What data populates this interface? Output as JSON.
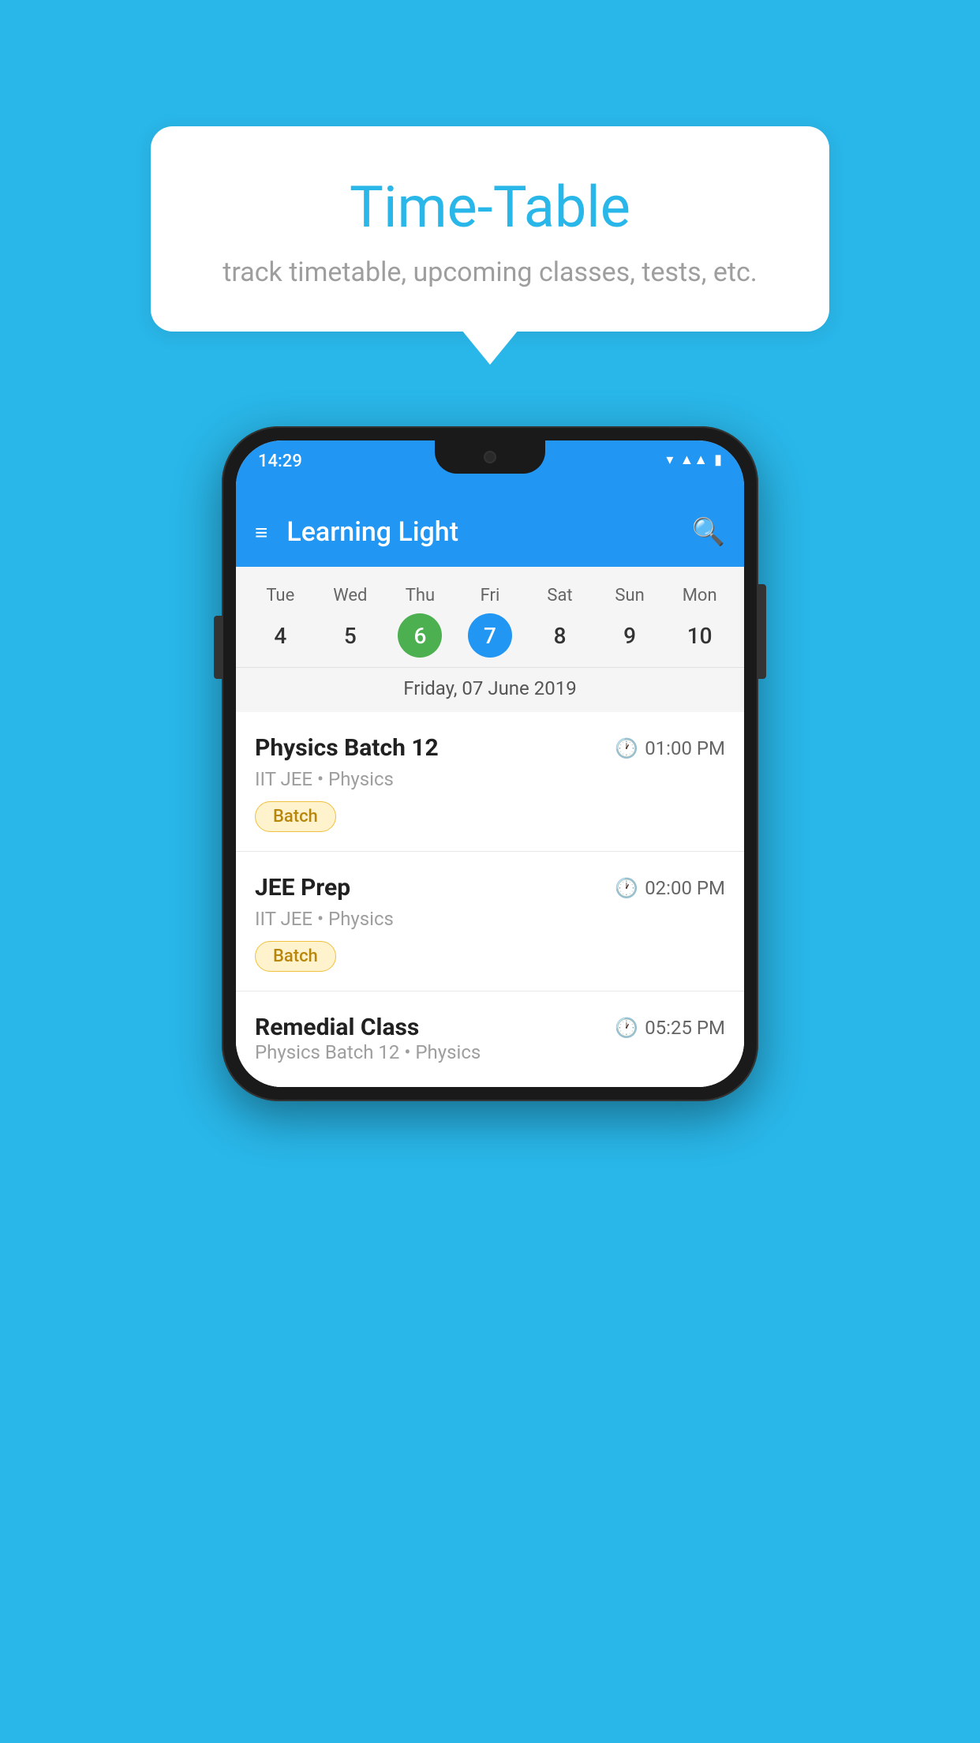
{
  "background_color": "#29B6E8",
  "bubble": {
    "title": "Time-Table",
    "subtitle": "track timetable, upcoming classes, tests, etc."
  },
  "phone": {
    "status_bar": {
      "time": "14:29"
    },
    "toolbar": {
      "title": "Learning Light"
    },
    "calendar": {
      "days": [
        {
          "label": "Tue",
          "num": "4",
          "state": "normal"
        },
        {
          "label": "Wed",
          "num": "5",
          "state": "normal"
        },
        {
          "label": "Thu",
          "num": "6",
          "state": "today"
        },
        {
          "label": "Fri",
          "num": "7",
          "state": "selected"
        },
        {
          "label": "Sat",
          "num": "8",
          "state": "normal"
        },
        {
          "label": "Sun",
          "num": "9",
          "state": "normal"
        },
        {
          "label": "Mon",
          "num": "10",
          "state": "normal"
        }
      ],
      "date_label": "Friday, 07 June 2019"
    },
    "schedule": [
      {
        "title": "Physics Batch 12",
        "time": "01:00 PM",
        "subtitle": "IIT JEE • Physics",
        "badge": "Batch"
      },
      {
        "title": "JEE Prep",
        "time": "02:00 PM",
        "subtitle": "IIT JEE • Physics",
        "badge": "Batch"
      },
      {
        "title": "Remedial Class",
        "time": "05:25 PM",
        "subtitle": "Physics Batch 12 • Physics",
        "badge": null
      }
    ]
  },
  "icons": {
    "hamburger": "≡",
    "search": "🔍",
    "clock": "🕐"
  }
}
